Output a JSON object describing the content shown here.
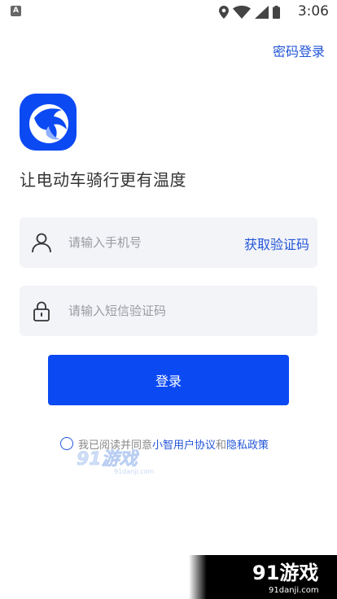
{
  "status_bar": {
    "app_badge": "A",
    "time": "3:06",
    "icons": [
      "app-notification-icon",
      "location-icon",
      "wifi-icon",
      "signal-icon",
      "battery-icon"
    ]
  },
  "header": {
    "password_login": "密码登录"
  },
  "brand": {
    "tagline": "让电动车骑行更有温度",
    "logo_color": "#0b49f3"
  },
  "form": {
    "phone_placeholder": "请输入手机号",
    "get_code": "获取验证码",
    "code_placeholder": "请输入短信验证码",
    "login_button": "登录",
    "accent_color": "#0b49f3"
  },
  "agreement": {
    "prefix": "我已阅读并同意",
    "user_agreement": "小智用户协议",
    "conjunction": "和",
    "privacy_policy": "隐私政策"
  },
  "watermark": {
    "center_logo": "91游戏",
    "center_url": "91danji.com",
    "bottom_logo": "91游戏",
    "bottom_url": "91danji.com"
  }
}
